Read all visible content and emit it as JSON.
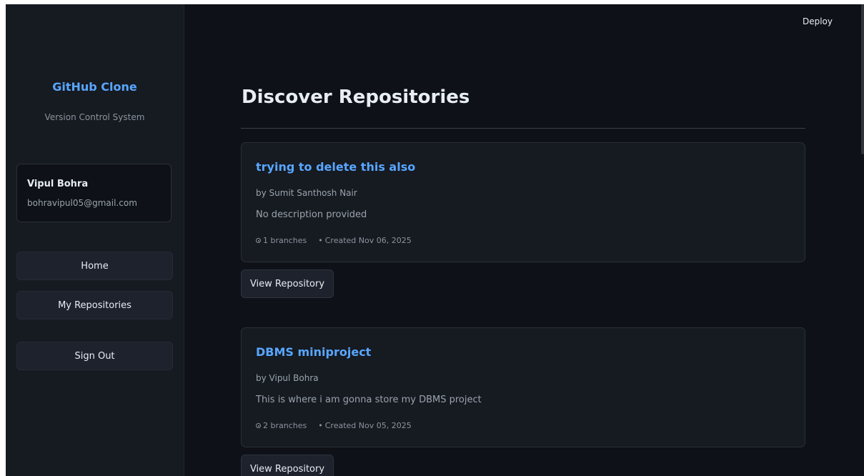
{
  "header": {
    "deploy_label": "Deploy"
  },
  "sidebar": {
    "brand_title": "GitHub Clone",
    "brand_subtitle": "Version Control System",
    "user": {
      "name": "Vipul Bohra",
      "email": "bohravipul05@gmail.com"
    },
    "nav": [
      {
        "label": "Home"
      },
      {
        "label": "My Repositories"
      },
      {
        "label": "Sign Out"
      }
    ]
  },
  "main": {
    "page_title": "Discover Repositories",
    "repos": [
      {
        "name": "trying to delete this also",
        "author": "by Sumit Santhosh Nair",
        "description": "No description provided",
        "branches": "1 branches",
        "created": "Created Nov 06, 2025",
        "view_label": "View Repository"
      },
      {
        "name": "DBMS miniproject",
        "author": "by Vipul Bohra",
        "description": "This is where i am gonna store my DBMS project",
        "branches": "2 branches",
        "created": "Created Nov 05, 2025",
        "view_label": "View Repository"
      }
    ]
  },
  "colors": {
    "background": "#0e1117",
    "sidebar": "#161a21",
    "accent": "#58a6ff",
    "text": "#e6edf3",
    "muted": "#9aa4ae"
  }
}
